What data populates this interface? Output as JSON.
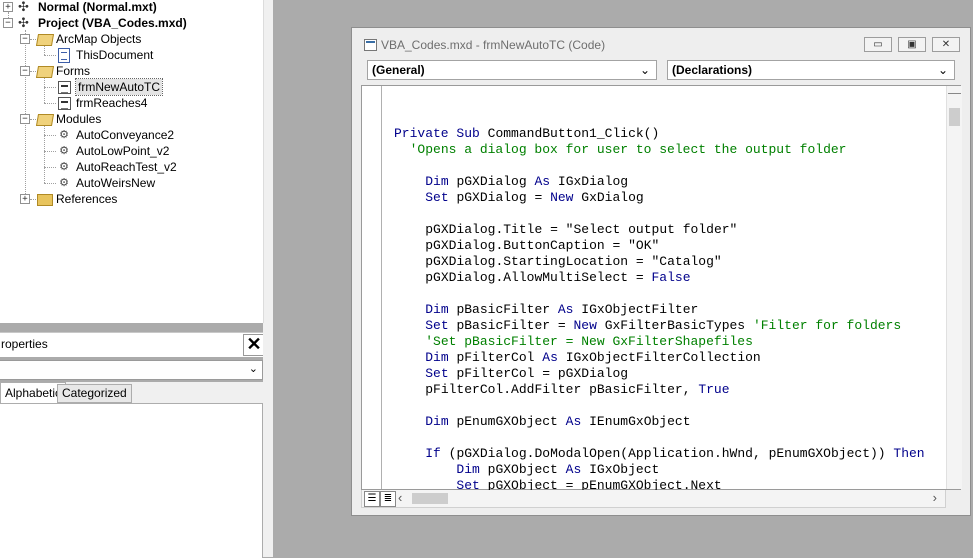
{
  "project_explorer": {
    "items": [
      {
        "label": "Normal (Normal.mxt)",
        "icon": "project-icon",
        "bold": true
      },
      {
        "label": "Project (VBA_Codes.mxd)",
        "icon": "project-icon",
        "bold": true
      },
      {
        "label": "ArcMap Objects",
        "icon": "folder-open-icon"
      },
      {
        "label": "ThisDocument",
        "icon": "document-icon"
      },
      {
        "label": "Forms",
        "icon": "folder-open-icon"
      },
      {
        "label": "frmNewAutoTC",
        "icon": "form-icon",
        "selected": true
      },
      {
        "label": "frmReaches4",
        "icon": "form-icon"
      },
      {
        "label": "Modules",
        "icon": "folder-open-icon"
      },
      {
        "label": "AutoConveyance2",
        "icon": "module-icon"
      },
      {
        "label": "AutoLowPoint_v2",
        "icon": "module-icon"
      },
      {
        "label": "AutoReachTest_v2",
        "icon": "module-icon"
      },
      {
        "label": "AutoWeirsNew",
        "icon": "module-icon"
      },
      {
        "label": "References",
        "icon": "folder-icon"
      }
    ]
  },
  "properties": {
    "title": "roperties",
    "combo_value": "",
    "tabs": [
      "Alphabetic",
      "Categorized"
    ]
  },
  "code_window": {
    "title": "VBA_Codes.mxd - frmNewAutoTC (Code)",
    "object_combo": "(General)",
    "procedure_combo": "(Declarations)",
    "code_lines": [
      "",
      "Private Sub CommandButton1_Click()",
      "  'Opens a dialog box for user to select the output folder",
      "",
      "    Dim pGXDialog As IGxDialog",
      "    Set pGXDialog = New GxDialog",
      "",
      "    pGXDialog.Title = \"Select output folder\"",
      "    pGXDialog.ButtonCaption = \"OK\"",
      "    pGXDialog.StartingLocation = \"Catalog\"",
      "    pGXDialog.AllowMultiSelect = False",
      "",
      "    Dim pBasicFilter As IGxObjectFilter",
      "    Set pBasicFilter = New GxFilterBasicTypes 'Filter for folders",
      "    'Set pBasicFilter = New GxFilterShapefiles",
      "    Dim pFilterCol As IGxObjectFilterCollection",
      "    Set pFilterCol = pGXDialog",
      "    pFilterCol.AddFilter pBasicFilter, True",
      "",
      "    Dim pEnumGXObject As IEnumGxObject",
      "",
      "    If (pGXDialog.DoModalOpen(Application.hWnd, pEnumGXObject)) Then",
      "        Dim pGXObject As IGxObject",
      "        Set pGXObject = pEnumGXObject.Next"
    ]
  },
  "colors": {
    "keyword": "#00008b",
    "comment": "#008000"
  }
}
